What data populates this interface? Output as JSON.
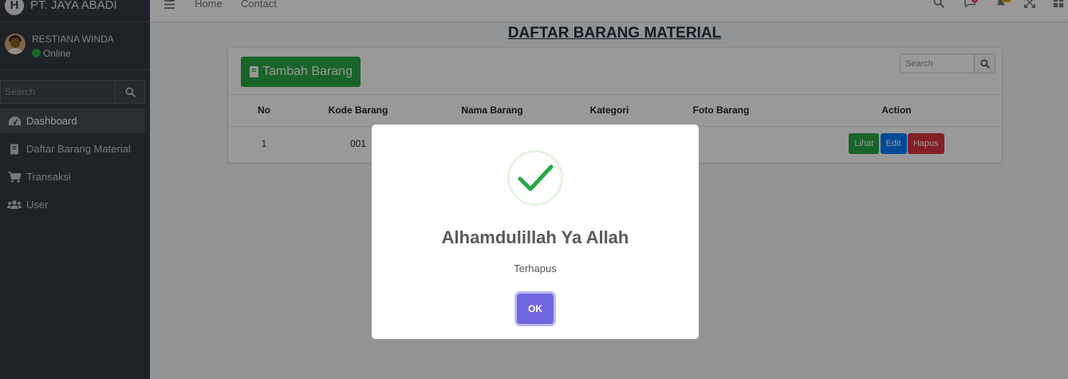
{
  "app": {
    "brand": "PT. JAYA ABADI",
    "brand_letter": "H"
  },
  "user": {
    "name": "RESTIANA WINDA",
    "status": "Online"
  },
  "sidebar": {
    "search_placeholder": "Search",
    "items": [
      {
        "label": "Dashboard",
        "icon": "tachometer-icon",
        "active": true
      },
      {
        "label": "Daftar Barang Material",
        "icon": "book-icon",
        "active": false
      },
      {
        "label": "Transaksi",
        "icon": "cart-icon",
        "active": false
      },
      {
        "label": "User",
        "icon": "users-icon",
        "active": false
      }
    ]
  },
  "topnav": {
    "links": [
      "Home",
      "Contact"
    ],
    "messages_badge": "3",
    "notifications_badge": "15"
  },
  "page": {
    "title": "DAFTAR BARANG MATERIAL"
  },
  "card": {
    "add_button": "Tambah Barang",
    "search_placeholder": "Search"
  },
  "table": {
    "headers": [
      "No",
      "Kode Barang",
      "Nama Barang",
      "Kategori",
      "Foto Barang",
      "Action"
    ],
    "rows": [
      {
        "no": "1",
        "kode": "001",
        "nama": "",
        "kategori": "",
        "foto": ""
      }
    ],
    "actions": {
      "view": "Lihat",
      "edit": "Edit",
      "delete": "Hapus"
    }
  },
  "modal": {
    "title": "Alhamdulillah Ya Allah",
    "text": "Terhapus",
    "ok_label": "OK",
    "icon": "success-check-icon"
  },
  "colors": {
    "sidebar_bg": "#343a40",
    "success": "#28a745",
    "primary": "#007bff",
    "danger": "#dc3545",
    "confirm": "#7066e0"
  }
}
